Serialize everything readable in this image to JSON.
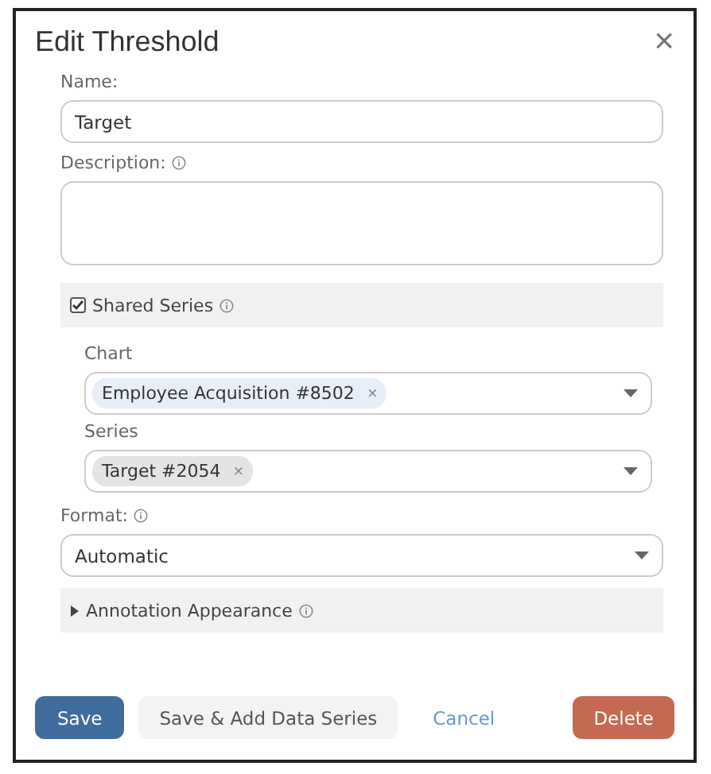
{
  "dialog": {
    "title": "Edit Threshold",
    "close": "×"
  },
  "name": {
    "label": "Name:",
    "value": "Target"
  },
  "description": {
    "label": "Description:"
  },
  "shared_series": {
    "label": "Shared Series",
    "checked": true,
    "fields": [
      {
        "label": "Chart",
        "chip": {
          "text": "Employee Acquisition #8502",
          "remove": "×",
          "color": "#e8eef8"
        }
      },
      {
        "label": "Series",
        "chip": {
          "text": "Target #2054",
          "remove": "×",
          "color": "#e4e4e4"
        }
      }
    ]
  },
  "format": {
    "label": "Format:",
    "value": "Automatic"
  },
  "annotation": {
    "label": "Annotation Appearance",
    "expanded": false
  },
  "buttons": [
    {
      "kind": "primary",
      "label": "Save"
    },
    {
      "kind": "secondary",
      "label": "Save & Add Data Series"
    },
    {
      "kind": "link",
      "label": "Cancel"
    },
    {
      "kind": "danger",
      "label": "Delete"
    }
  ]
}
